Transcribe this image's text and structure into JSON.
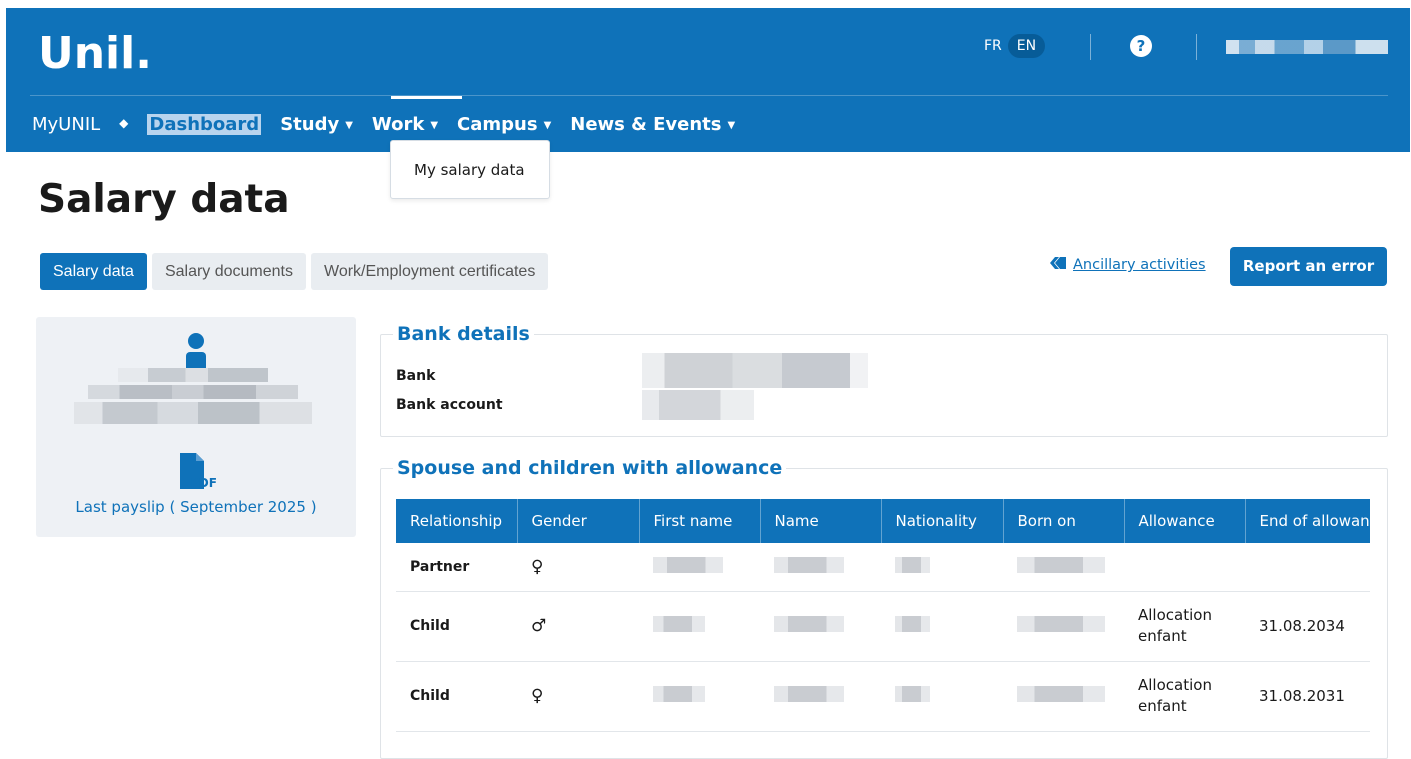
{
  "header": {
    "logo": "Unil.",
    "lang_fr": "FR",
    "lang_en": "EN",
    "help_icon": "?",
    "icon_names": {
      "help": "question-circle-icon",
      "user": "user-menu"
    }
  },
  "nav": {
    "home": "MyUNIL",
    "separator": "◆",
    "items": [
      "Dashboard",
      "Study",
      "Work",
      "Campus",
      "News & Events"
    ],
    "dropdown_item": "My salary data"
  },
  "page": {
    "title": "Salary data",
    "tabs": [
      "Salary data",
      "Salary documents",
      "Work/Employment certificates"
    ],
    "ancillary_link": "Ancillary activities",
    "report_button": "Report an error"
  },
  "profile": {
    "payslip_link": "Last payslip ( September 2025 )",
    "pdf_label": "PDF",
    "icon_names": {
      "person": "person-icon",
      "pdf": "pdf-file-icon"
    }
  },
  "bank": {
    "legend": "Bank details",
    "bank_label": "Bank",
    "account_label": "Bank account"
  },
  "allowances": {
    "legend": "Spouse and children with allowance",
    "columns": [
      "Relationship",
      "Gender",
      "First name",
      "Name",
      "Nationality",
      "Born on",
      "Allowance",
      "End of allowance"
    ],
    "rows": [
      {
        "relationship": "Partner",
        "gender": "♀",
        "allowance": "",
        "end": ""
      },
      {
        "relationship": "Child",
        "gender": "♂",
        "allowance": "Allocation enfant",
        "end": "31.08.2034"
      },
      {
        "relationship": "Child",
        "gender": "♀",
        "allowance": "Allocation enfant",
        "end": "31.08.2031"
      }
    ]
  },
  "colors": {
    "brand": "#0f72b9",
    "panel": "#eef1f5",
    "tab_inactive": "#e9edf1"
  }
}
